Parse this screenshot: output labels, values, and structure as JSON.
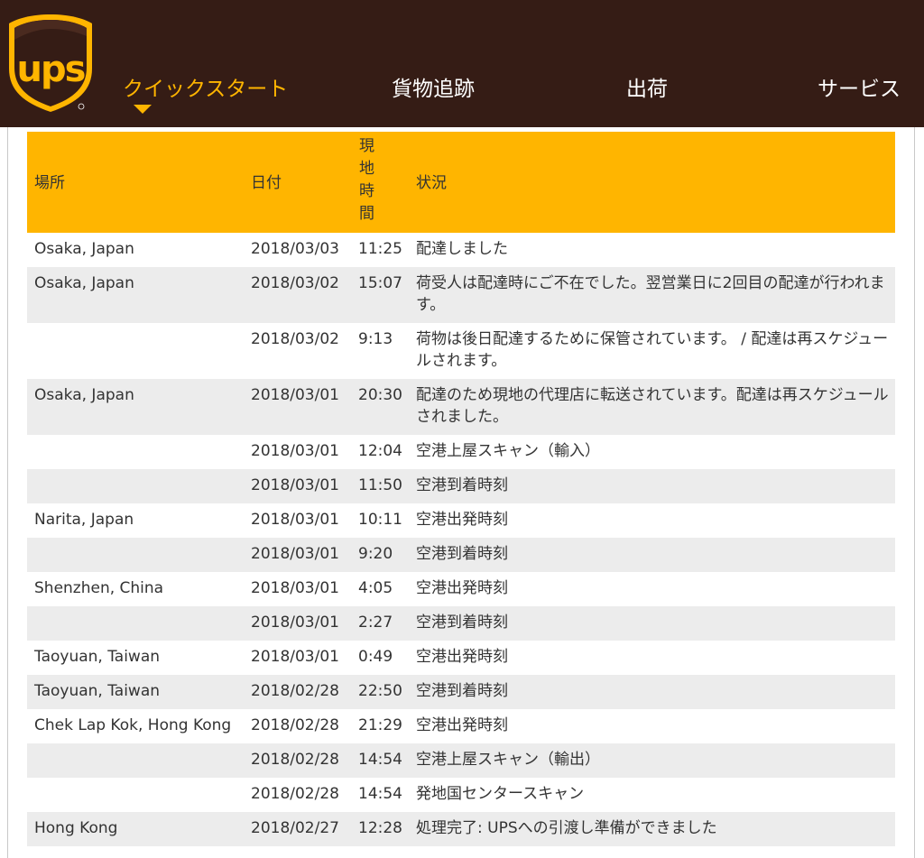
{
  "brand": {
    "logo_text": "ups",
    "brown": "#351c15",
    "gold": "#ffb500"
  },
  "nav": {
    "items": [
      {
        "label": "クイックスタート",
        "active": true
      },
      {
        "label": "貨物追跡",
        "active": false
      },
      {
        "label": "出荷",
        "active": false
      },
      {
        "label": "サービス",
        "active": false
      }
    ]
  },
  "table": {
    "headers": {
      "location": "場所",
      "date": "日付",
      "local_time": "現地時間",
      "status": "状況"
    },
    "rows": [
      {
        "location": "Osaka, Japan",
        "date": "2018/03/03",
        "time": "11:25",
        "status": "配達しました"
      },
      {
        "location": "Osaka, Japan",
        "date": "2018/03/02",
        "time": "15:07",
        "status": "荷受人は配達時にご不在でした。翌営業日に2回目の配達が行われます。"
      },
      {
        "location": "",
        "date": "2018/03/02",
        "time": "9:13",
        "status": "荷物は後日配達するために保管されています。 / 配達は再スケジュールされます。"
      },
      {
        "location": "Osaka, Japan",
        "date": "2018/03/01",
        "time": "20:30",
        "status": "配達のため現地の代理店に転送されています。配達は再スケジュールされました。"
      },
      {
        "location": "",
        "date": "2018/03/01",
        "time": "12:04",
        "status": "空港上屋スキャン（輸入）"
      },
      {
        "location": "",
        "date": "2018/03/01",
        "time": "11:50",
        "status": "空港到着時刻"
      },
      {
        "location": "Narita, Japan",
        "date": "2018/03/01",
        "time": "10:11",
        "status": "空港出発時刻"
      },
      {
        "location": "",
        "date": "2018/03/01",
        "time": "9:20",
        "status": "空港到着時刻"
      },
      {
        "location": "Shenzhen, China",
        "date": "2018/03/01",
        "time": "4:05",
        "status": "空港出発時刻"
      },
      {
        "location": "",
        "date": "2018/03/01",
        "time": "2:27",
        "status": "空港到着時刻"
      },
      {
        "location": "Taoyuan, Taiwan",
        "date": "2018/03/01",
        "time": "0:49",
        "status": "空港出発時刻"
      },
      {
        "location": "Taoyuan, Taiwan",
        "date": "2018/02/28",
        "time": "22:50",
        "status": "空港到着時刻"
      },
      {
        "location": "Chek Lap Kok, Hong Kong",
        "date": "2018/02/28",
        "time": "21:29",
        "status": "空港出発時刻"
      },
      {
        "location": "",
        "date": "2018/02/28",
        "time": "14:54",
        "status": "空港上屋スキャン（輸出）"
      },
      {
        "location": "",
        "date": "2018/02/28",
        "time": "14:54",
        "status": "発地国センタースキャン"
      },
      {
        "location": "Hong Kong",
        "date": "2018/02/27",
        "time": "12:28",
        "status": "処理完了: UPSへの引渡し準備ができました"
      }
    ]
  }
}
